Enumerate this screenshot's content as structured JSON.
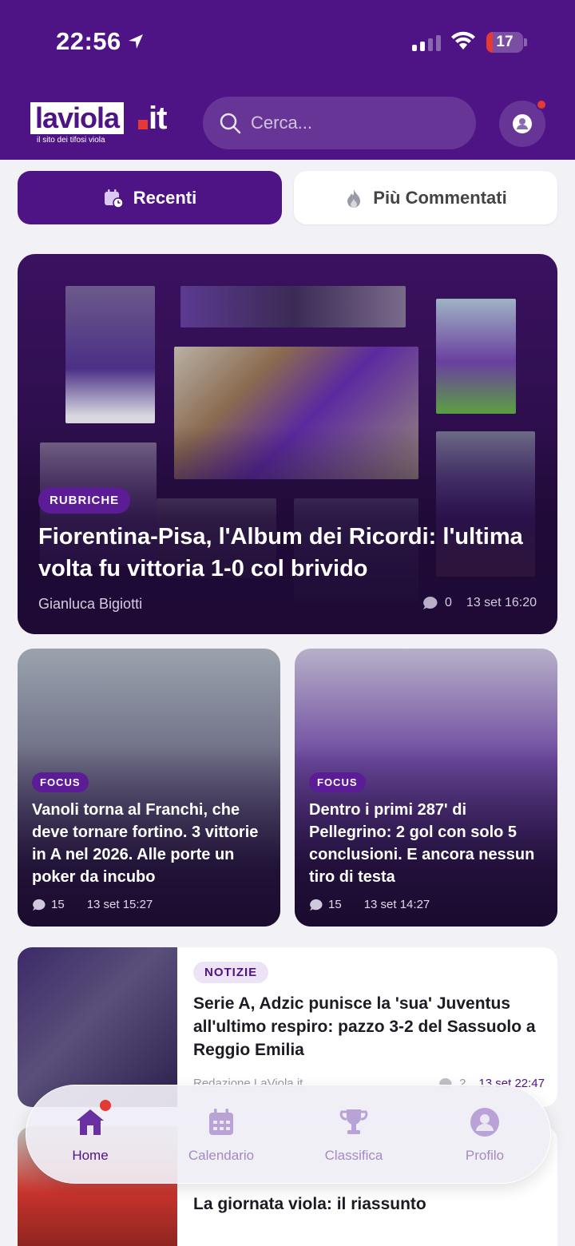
{
  "status_bar": {
    "time": "22:56",
    "battery": "17",
    "battery_level_percent": 17
  },
  "brand": {
    "name": "laviola",
    "tld": "it",
    "tagline": "il sito dei tifosi viola"
  },
  "search": {
    "placeholder": "Cerca..."
  },
  "segments": {
    "recent": "Recenti",
    "most_commented": "Più Commentati"
  },
  "hero": {
    "category": "RUBRICHE",
    "title": "Fiorentina-Pisa, l'Album dei Ricordi: l'ultima volta fu vittoria 1-0 col brivido",
    "author": "Gianluca Bigiotti",
    "comments": "0",
    "date": "13 set 16:20"
  },
  "cards": [
    {
      "category": "FOCUS",
      "title": "Vanoli torna al Franchi, che deve tornare fortino. 3 vittorie in A nel 2026. Alle porte un poker da incubo",
      "comments": "15",
      "date": "13 set 15:27"
    },
    {
      "category": "FOCUS",
      "title": "Dentro i primi 287' di Pellegrino: 2 gol con solo 5 conclusioni. E ancora nessun tiro di testa",
      "comments": "15",
      "date": "13 set 14:27"
    }
  ],
  "list": [
    {
      "category": "NOTIZIE",
      "title": "Serie A, Adzic punisce la 'sua' Juventus all'ultimo respiro: pazzo 3-2 del Sassuolo a Reggio Emilia",
      "author": "Redazione LaViola.it",
      "comments": "2",
      "date": "13 set 22:47"
    },
    {
      "title": "La giornata viola: il riassunto"
    }
  ],
  "tabs": [
    {
      "label": "Home",
      "icon": "home-icon",
      "active": true
    },
    {
      "label": "Calendario",
      "icon": "calendar-icon"
    },
    {
      "label": "Classifica",
      "icon": "trophy-icon"
    },
    {
      "label": "Profilo",
      "icon": "user-icon"
    }
  ],
  "colors": {
    "brand_purple": "#4e1485",
    "accent_red": "#e53935",
    "tab_inactive": "#a28bc0"
  }
}
